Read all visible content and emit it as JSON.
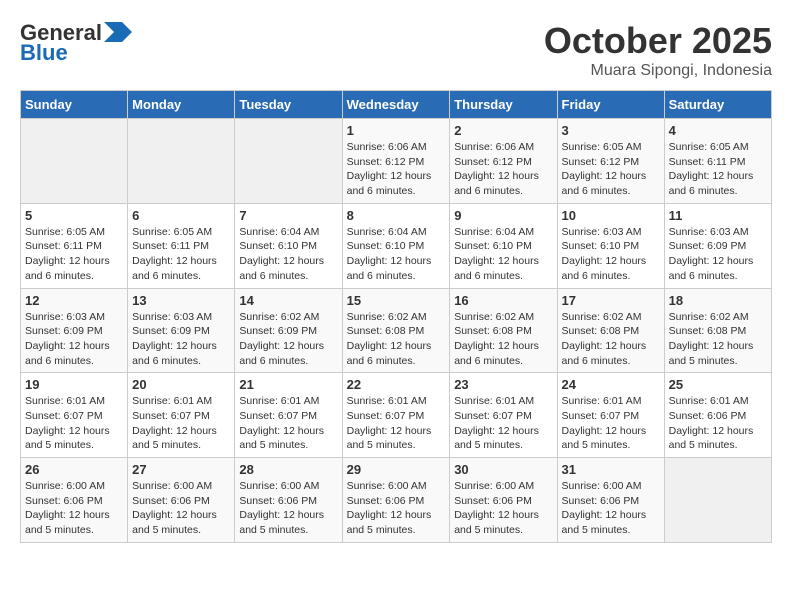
{
  "header": {
    "logo_general": "General",
    "logo_blue": "Blue",
    "main_title": "October 2025",
    "subtitle": "Muara Sipongi, Indonesia"
  },
  "days_of_week": [
    "Sunday",
    "Monday",
    "Tuesday",
    "Wednesday",
    "Thursday",
    "Friday",
    "Saturday"
  ],
  "weeks": [
    [
      {
        "day": "",
        "sunrise": "",
        "sunset": "",
        "daylight": "",
        "empty": true
      },
      {
        "day": "",
        "sunrise": "",
        "sunset": "",
        "daylight": "",
        "empty": true
      },
      {
        "day": "",
        "sunrise": "",
        "sunset": "",
        "daylight": "",
        "empty": true
      },
      {
        "day": "1",
        "sunrise": "Sunrise: 6:06 AM",
        "sunset": "Sunset: 6:12 PM",
        "daylight": "Daylight: 12 hours and 6 minutes."
      },
      {
        "day": "2",
        "sunrise": "Sunrise: 6:06 AM",
        "sunset": "Sunset: 6:12 PM",
        "daylight": "Daylight: 12 hours and 6 minutes."
      },
      {
        "day": "3",
        "sunrise": "Sunrise: 6:05 AM",
        "sunset": "Sunset: 6:12 PM",
        "daylight": "Daylight: 12 hours and 6 minutes."
      },
      {
        "day": "4",
        "sunrise": "Sunrise: 6:05 AM",
        "sunset": "Sunset: 6:11 PM",
        "daylight": "Daylight: 12 hours and 6 minutes."
      }
    ],
    [
      {
        "day": "5",
        "sunrise": "Sunrise: 6:05 AM",
        "sunset": "Sunset: 6:11 PM",
        "daylight": "Daylight: 12 hours and 6 minutes."
      },
      {
        "day": "6",
        "sunrise": "Sunrise: 6:05 AM",
        "sunset": "Sunset: 6:11 PM",
        "daylight": "Daylight: 12 hours and 6 minutes."
      },
      {
        "day": "7",
        "sunrise": "Sunrise: 6:04 AM",
        "sunset": "Sunset: 6:10 PM",
        "daylight": "Daylight: 12 hours and 6 minutes."
      },
      {
        "day": "8",
        "sunrise": "Sunrise: 6:04 AM",
        "sunset": "Sunset: 6:10 PM",
        "daylight": "Daylight: 12 hours and 6 minutes."
      },
      {
        "day": "9",
        "sunrise": "Sunrise: 6:04 AM",
        "sunset": "Sunset: 6:10 PM",
        "daylight": "Daylight: 12 hours and 6 minutes."
      },
      {
        "day": "10",
        "sunrise": "Sunrise: 6:03 AM",
        "sunset": "Sunset: 6:10 PM",
        "daylight": "Daylight: 12 hours and 6 minutes."
      },
      {
        "day": "11",
        "sunrise": "Sunrise: 6:03 AM",
        "sunset": "Sunset: 6:09 PM",
        "daylight": "Daylight: 12 hours and 6 minutes."
      }
    ],
    [
      {
        "day": "12",
        "sunrise": "Sunrise: 6:03 AM",
        "sunset": "Sunset: 6:09 PM",
        "daylight": "Daylight: 12 hours and 6 minutes."
      },
      {
        "day": "13",
        "sunrise": "Sunrise: 6:03 AM",
        "sunset": "Sunset: 6:09 PM",
        "daylight": "Daylight: 12 hours and 6 minutes."
      },
      {
        "day": "14",
        "sunrise": "Sunrise: 6:02 AM",
        "sunset": "Sunset: 6:09 PM",
        "daylight": "Daylight: 12 hours and 6 minutes."
      },
      {
        "day": "15",
        "sunrise": "Sunrise: 6:02 AM",
        "sunset": "Sunset: 6:08 PM",
        "daylight": "Daylight: 12 hours and 6 minutes."
      },
      {
        "day": "16",
        "sunrise": "Sunrise: 6:02 AM",
        "sunset": "Sunset: 6:08 PM",
        "daylight": "Daylight: 12 hours and 6 minutes."
      },
      {
        "day": "17",
        "sunrise": "Sunrise: 6:02 AM",
        "sunset": "Sunset: 6:08 PM",
        "daylight": "Daylight: 12 hours and 6 minutes."
      },
      {
        "day": "18",
        "sunrise": "Sunrise: 6:02 AM",
        "sunset": "Sunset: 6:08 PM",
        "daylight": "Daylight: 12 hours and 5 minutes."
      }
    ],
    [
      {
        "day": "19",
        "sunrise": "Sunrise: 6:01 AM",
        "sunset": "Sunset: 6:07 PM",
        "daylight": "Daylight: 12 hours and 5 minutes."
      },
      {
        "day": "20",
        "sunrise": "Sunrise: 6:01 AM",
        "sunset": "Sunset: 6:07 PM",
        "daylight": "Daylight: 12 hours and 5 minutes."
      },
      {
        "day": "21",
        "sunrise": "Sunrise: 6:01 AM",
        "sunset": "Sunset: 6:07 PM",
        "daylight": "Daylight: 12 hours and 5 minutes."
      },
      {
        "day": "22",
        "sunrise": "Sunrise: 6:01 AM",
        "sunset": "Sunset: 6:07 PM",
        "daylight": "Daylight: 12 hours and 5 minutes."
      },
      {
        "day": "23",
        "sunrise": "Sunrise: 6:01 AM",
        "sunset": "Sunset: 6:07 PM",
        "daylight": "Daylight: 12 hours and 5 minutes."
      },
      {
        "day": "24",
        "sunrise": "Sunrise: 6:01 AM",
        "sunset": "Sunset: 6:07 PM",
        "daylight": "Daylight: 12 hours and 5 minutes."
      },
      {
        "day": "25",
        "sunrise": "Sunrise: 6:01 AM",
        "sunset": "Sunset: 6:06 PM",
        "daylight": "Daylight: 12 hours and 5 minutes."
      }
    ],
    [
      {
        "day": "26",
        "sunrise": "Sunrise: 6:00 AM",
        "sunset": "Sunset: 6:06 PM",
        "daylight": "Daylight: 12 hours and 5 minutes."
      },
      {
        "day": "27",
        "sunrise": "Sunrise: 6:00 AM",
        "sunset": "Sunset: 6:06 PM",
        "daylight": "Daylight: 12 hours and 5 minutes."
      },
      {
        "day": "28",
        "sunrise": "Sunrise: 6:00 AM",
        "sunset": "Sunset: 6:06 PM",
        "daylight": "Daylight: 12 hours and 5 minutes."
      },
      {
        "day": "29",
        "sunrise": "Sunrise: 6:00 AM",
        "sunset": "Sunset: 6:06 PM",
        "daylight": "Daylight: 12 hours and 5 minutes."
      },
      {
        "day": "30",
        "sunrise": "Sunrise: 6:00 AM",
        "sunset": "Sunset: 6:06 PM",
        "daylight": "Daylight: 12 hours and 5 minutes."
      },
      {
        "day": "31",
        "sunrise": "Sunrise: 6:00 AM",
        "sunset": "Sunset: 6:06 PM",
        "daylight": "Daylight: 12 hours and 5 minutes."
      },
      {
        "day": "",
        "sunrise": "",
        "sunset": "",
        "daylight": "",
        "empty": true
      }
    ]
  ]
}
